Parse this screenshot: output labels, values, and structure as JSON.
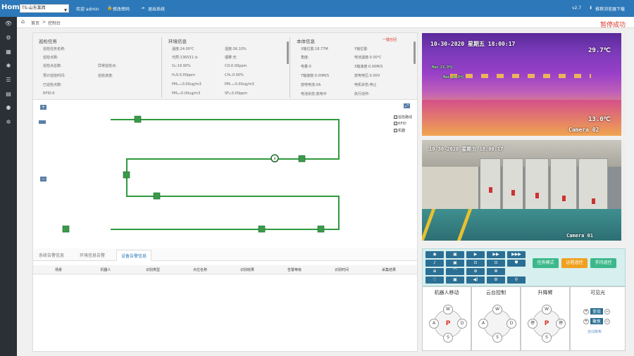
{
  "topbar": {
    "brand": "Home",
    "site_select": "TS-山东莱西",
    "welcome": "欢迎 admin",
    "change_password": "修改密码",
    "logout": "退出系统",
    "version": "v2.7",
    "download": "推荐浏览器下载"
  },
  "breadcrumb": {
    "home": "首页",
    "sep": ">",
    "current": "控制台"
  },
  "status_message": "暂停成功",
  "info": {
    "patrol": {
      "title": "巡检任务",
      "fields": [
        "巡检任务名称:",
        "巡检点数:",
        "巡检点总数:",
        "已巡检点数:",
        "预计巡检时间:",
        "已巡检点数:",
        "RFID:0"
      ],
      "right_fields": [
        "异常巡检点:",
        "巡检进度:"
      ]
    },
    "env": {
      "title": "环境信息",
      "left": [
        "温度:24.00℃",
        "光照:136531 lx",
        "O₂:19.90%",
        "H₂S:0.00ppm",
        "PM₂.₅:0.00ug/m3",
        "PM₁₀:0.00ug/m3"
      ],
      "right": [
        "湿度:36.10%",
        "烟雾:无",
        "CO:0.00ppm",
        "CH₄:0.00%",
        "PM₁.₀:0.00ug/m3",
        "SF₆:0.00ppm"
      ]
    },
    "robot": {
      "title": "本体信息",
      "alert": "一键召回",
      "left": [
        "X轴位置:18.77M",
        "角度:",
        "电量:0",
        "Y轴速度:0.00M/S",
        "放电电流:0A",
        "电池状态:放电中"
      ],
      "right": [
        "Y轴位置:",
        "电池温度:0.00℃",
        "X轴速度:0.00M/S",
        "放电电压:0.00V",
        "电机状态:停止",
        "执行动作:"
      ]
    }
  },
  "map": {
    "zoom_in": "+",
    "zoom_out": "−",
    "legend": [
      "巡检路线",
      "RFID",
      "机器"
    ]
  },
  "tabs": [
    "系统告警信息",
    "环境信息告警",
    "设备告警信息"
  ],
  "active_tab": 2,
  "table": {
    "headers": [
      "场景",
      "机器人",
      "识别类型",
      "点位名称",
      "识别结果",
      "告警等级",
      "识别时间",
      "采集结果"
    ]
  },
  "cameras": {
    "thermal": {
      "timestamp": "10-30-2020 星期五 18:00:17",
      "max_temp": "29.7℃",
      "min_temp": "13.0℃",
      "label": "Camera 02",
      "spot1": "Max 23.9℃",
      "spot2": "Max 14.8℃"
    },
    "visible": {
      "timestamp": "10-30-2020 星期五 18:00:17",
      "label": "Camera 01"
    }
  },
  "controls": {
    "modes": [
      "任务模式",
      "远程遥控",
      "手持遥控"
    ],
    "mode_colors": [
      "#3cb88a",
      "#f0a020",
      "#3cb88a"
    ],
    "sections": [
      "机器人移动",
      "云台控制",
      "升降臂",
      "可见光"
    ],
    "pad_move": {
      "up": "W",
      "down": "S",
      "left": "A",
      "right": "D",
      "center": "P"
    },
    "pad_ptz": {
      "up": "W",
      "down": "S",
      "left": "A",
      "right": "D"
    },
    "pad_arm": {
      "up": "W",
      "down": "S",
      "left": "停",
      "right": "停",
      "center": "P"
    },
    "visible": {
      "zoom": "变倍",
      "focus": "聚焦",
      "link": "自动聚焦"
    }
  }
}
